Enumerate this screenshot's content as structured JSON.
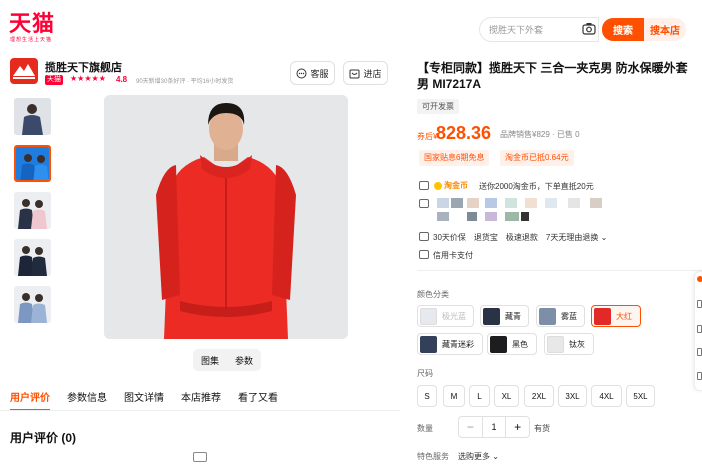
{
  "header": {
    "logo": "天猫",
    "logo_sub": "理想生活上天猫",
    "search_placeholder": "搅胜天下外套",
    "search_button": "搜索",
    "shop_search_button": "搜本店"
  },
  "shop": {
    "name": "揽胜天下旗舰店",
    "badge": "天猫",
    "stars": "★★★★★",
    "rating": "4.8",
    "stats": "90天新增30条好评 · 平均16小时发货",
    "service_button": "客服",
    "enter_button": "进店"
  },
  "gallery": {
    "segments": [
      "图集",
      "参数"
    ],
    "thumbnails": [
      "thumb-1",
      "thumb-2",
      "thumb-3",
      "thumb-4",
      "thumb-5"
    ]
  },
  "tabs": [
    "用户评价",
    "参数信息",
    "图文详情",
    "本店推荐",
    "看了又看"
  ],
  "reviews": {
    "title": "用户评价 (0)"
  },
  "product": {
    "title": "【专柜同款】揽胜天下 三合一夹克男 防水保暖外套男 MI7217A",
    "tag": "可开发票",
    "price_label": "券后¥",
    "price": "828.36",
    "orig_price": "品牌销售¥829 · 已售 0",
    "coupons": [
      "国家贴息6期免息",
      "淘金币已抵0.64元"
    ],
    "taobao_coin": "淘金币",
    "coin_desc": "送你2000淘金币，下单直抵20元",
    "services": [
      "30天价保",
      "退货宝",
      "极速退款",
      "7天无理由退换 ⌄"
    ],
    "credit": "信用卡支付"
  },
  "sku": {
    "color_label": "颜色分类",
    "colors": [
      {
        "name": "极光蓝",
        "swatch": "#e6e9ee",
        "state": "disabled"
      },
      {
        "name": "藏青",
        "swatch": "#2a3246",
        "state": "normal"
      },
      {
        "name": "雾蓝",
        "swatch": "#7c8ea8",
        "state": "normal"
      },
      {
        "name": "大红",
        "swatch": "#e12a27",
        "state": "selected"
      },
      {
        "name": "藏青迷彩",
        "swatch": "#33405a",
        "state": "normal"
      },
      {
        "name": "黑色",
        "swatch": "#1d1d1f",
        "state": "normal"
      },
      {
        "name": "钛灰",
        "swatch": "#e8e8e8",
        "state": "normal"
      }
    ],
    "size_label": "尺码",
    "sizes": [
      "S",
      "M",
      "L",
      "XL",
      "2XL",
      "3XL",
      "4XL",
      "5XL"
    ],
    "qty_label": "数量",
    "qty_minus": "−",
    "qty_value": "1",
    "qty_plus": "+",
    "stock": "有货",
    "svc_label": "特色服务",
    "svc_select": "选购更多 ⌄"
  },
  "colors": {
    "accent": "#ff5000",
    "tmall": "#ff0036"
  }
}
